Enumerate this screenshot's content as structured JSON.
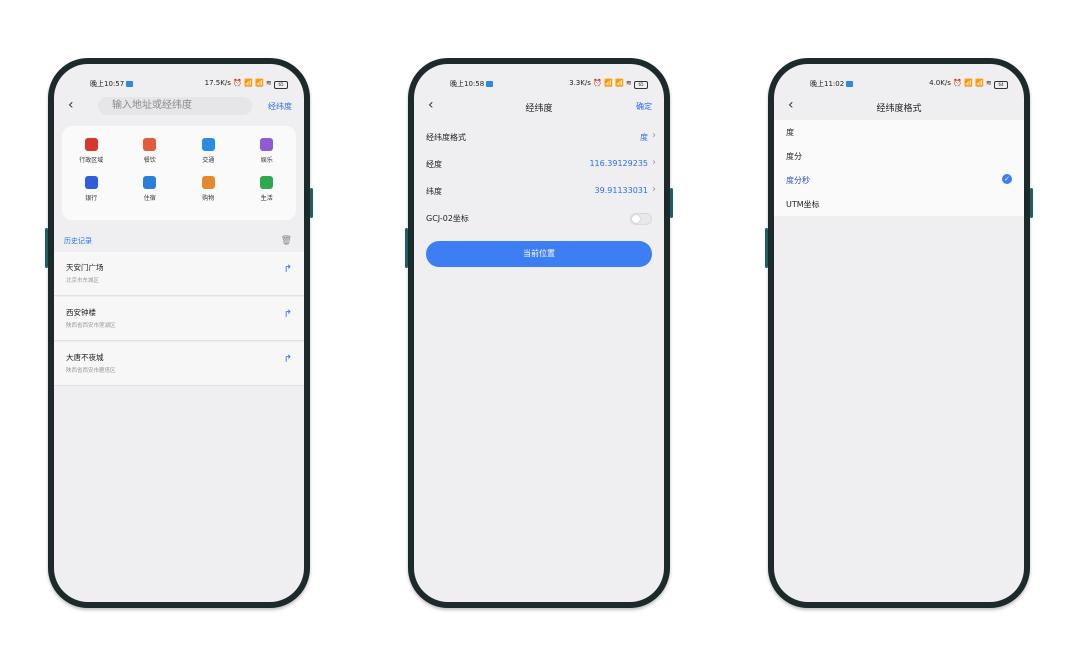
{
  "phones": [
    {
      "status": {
        "time": "晚上10:57",
        "right": "17.5K/s ⏰ 📶 📶 ≋",
        "battery": "65"
      },
      "nav": {
        "back": "‹",
        "search_placeholder": "输入地址或经纬度",
        "right": "经纬度"
      },
      "categories": [
        {
          "label": "行政区域",
          "icon": "government-icon",
          "color": "#d6382f"
        },
        {
          "label": "餐饮",
          "icon": "dining-icon",
          "color": "#e45a3c"
        },
        {
          "label": "交通",
          "icon": "transit-icon",
          "color": "#2a8be0"
        },
        {
          "label": "娱乐",
          "icon": "entertainment-icon",
          "color": "#8e5bd4"
        },
        {
          "label": "银行",
          "icon": "bank-icon",
          "color": "#2f5fd8"
        },
        {
          "label": "住宿",
          "icon": "hotel-icon",
          "color": "#2a7fd8"
        },
        {
          "label": "购物",
          "icon": "shopping-icon",
          "color": "#e38a2e"
        },
        {
          "label": "生活",
          "icon": "life-icon",
          "color": "#2fa84f"
        }
      ],
      "history": {
        "title": "历史记录",
        "items": [
          {
            "name": "天安门广场",
            "address": "北京市东城区"
          },
          {
            "name": "西安钟楼",
            "address": "陕西省西安市莲湖区"
          },
          {
            "name": "大唐不夜城",
            "address": "陕西省西安市雁塔区"
          }
        ]
      }
    },
    {
      "status": {
        "time": "晚上10:58",
        "right": "3.3K/s ⏰ 📶 📶 ≋",
        "battery": "65"
      },
      "nav": {
        "back": "‹",
        "title": "经纬度",
        "right": "确定"
      },
      "rows": [
        {
          "label": "经纬度格式",
          "value": "度"
        },
        {
          "label": "经度",
          "value": "116.39129235"
        },
        {
          "label": "纬度",
          "value": "39.91133031"
        },
        {
          "label": "GCJ-02坐标",
          "toggle": false
        }
      ],
      "button": "当前位置"
    },
    {
      "status": {
        "time": "晚上11:02",
        "right": "4.0K/s ⏰ 📶 📶 ≋",
        "battery": "64"
      },
      "nav": {
        "back": "‹",
        "title": "经纬度格式"
      },
      "options": [
        {
          "label": "度",
          "selected": false
        },
        {
          "label": "度分",
          "selected": false
        },
        {
          "label": "度分秒",
          "selected": true
        },
        {
          "label": "UTM坐标",
          "selected": false
        }
      ],
      "check": "✓"
    }
  ],
  "colors": {
    "accent": "#3d7ef2",
    "link": "#2b6fe6",
    "frame": "#1c2a2c"
  }
}
